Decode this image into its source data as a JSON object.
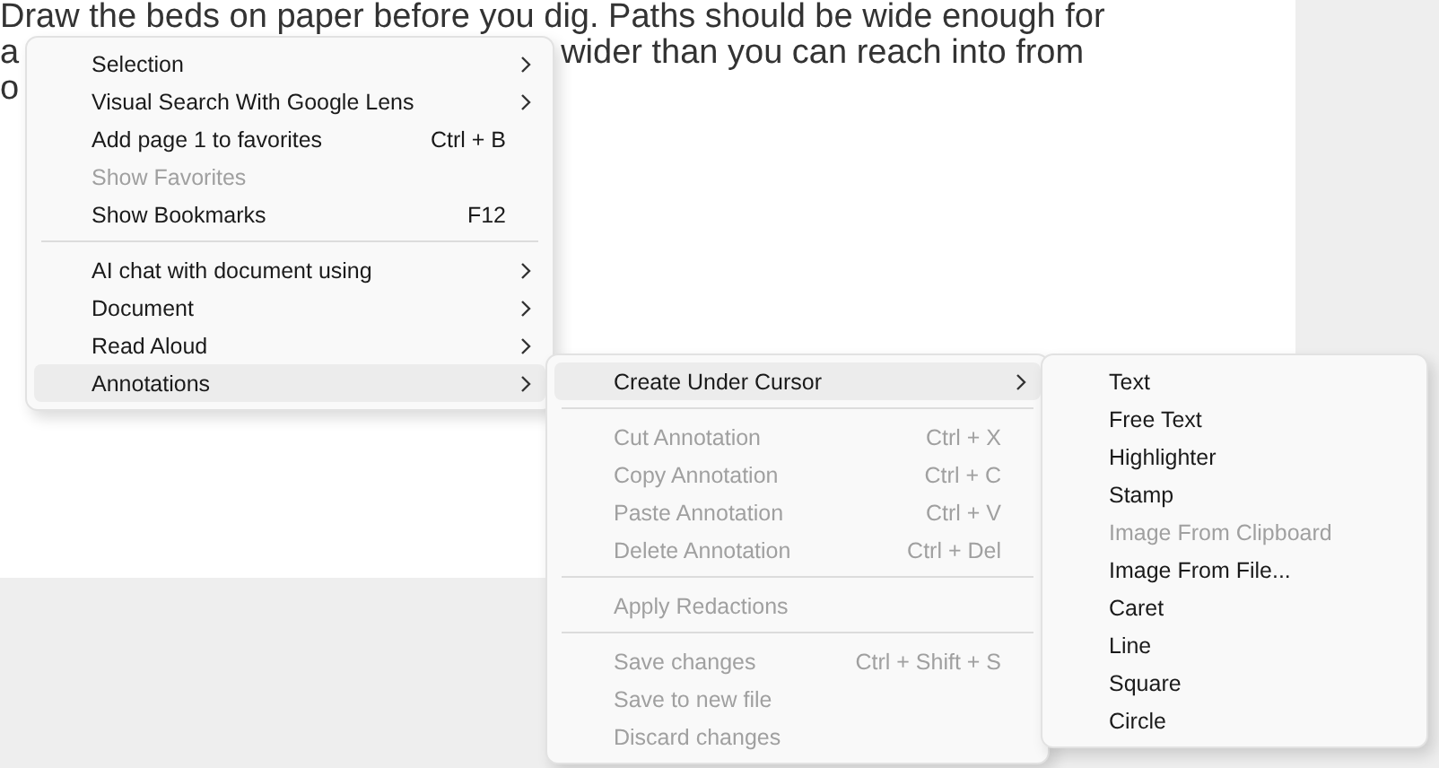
{
  "document": {
    "lines": [
      {
        "fragments": [
          "Draw the beds on paper before you dig. Paths should be wide enough for"
        ]
      },
      {
        "fragments": [
          "a",
          "wider than you can reach into from"
        ]
      },
      {
        "fragments": [
          "o"
        ]
      }
    ]
  },
  "context_menu": {
    "items": [
      {
        "kind": "item",
        "label": "Selection",
        "submenu": true,
        "disabled": false,
        "highlighted": false
      },
      {
        "kind": "item",
        "label": "Visual Search With Google Lens",
        "submenu": true,
        "disabled": false,
        "highlighted": false
      },
      {
        "kind": "item",
        "label": "Add page 1 to favorites",
        "shortcut": "Ctrl + B",
        "submenu": false,
        "disabled": false,
        "highlighted": false
      },
      {
        "kind": "item",
        "label": "Show Favorites",
        "submenu": false,
        "disabled": true,
        "highlighted": false
      },
      {
        "kind": "item",
        "label": "Show Bookmarks",
        "shortcut": "F12",
        "submenu": false,
        "disabled": false,
        "highlighted": false
      },
      {
        "kind": "separator"
      },
      {
        "kind": "item",
        "label": "AI chat with document using",
        "submenu": true,
        "disabled": false,
        "highlighted": false
      },
      {
        "kind": "item",
        "label": "Document",
        "submenu": true,
        "disabled": false,
        "highlighted": false
      },
      {
        "kind": "item",
        "label": "Read Aloud",
        "submenu": true,
        "disabled": false,
        "highlighted": false
      },
      {
        "kind": "item",
        "label": "Annotations",
        "submenu": true,
        "disabled": false,
        "highlighted": true
      }
    ]
  },
  "annotations_submenu": {
    "items": [
      {
        "kind": "item",
        "label": "Create Under Cursor",
        "submenu": true,
        "disabled": false,
        "highlighted": true
      },
      {
        "kind": "separator"
      },
      {
        "kind": "item",
        "label": "Cut Annotation",
        "shortcut": "Ctrl + X",
        "submenu": false,
        "disabled": true,
        "highlighted": false
      },
      {
        "kind": "item",
        "label": "Copy Annotation",
        "shortcut": "Ctrl + C",
        "submenu": false,
        "disabled": true,
        "highlighted": false
      },
      {
        "kind": "item",
        "label": "Paste Annotation",
        "shortcut": "Ctrl + V",
        "submenu": false,
        "disabled": true,
        "highlighted": false
      },
      {
        "kind": "item",
        "label": "Delete Annotation",
        "shortcut": "Ctrl + Del",
        "submenu": false,
        "disabled": true,
        "highlighted": false
      },
      {
        "kind": "separator"
      },
      {
        "kind": "item",
        "label": "Apply Redactions",
        "submenu": false,
        "disabled": true,
        "highlighted": false
      },
      {
        "kind": "separator"
      },
      {
        "kind": "item",
        "label": "Save changes",
        "shortcut": "Ctrl + Shift + S",
        "submenu": false,
        "disabled": true,
        "highlighted": false
      },
      {
        "kind": "item",
        "label": "Save to new file",
        "submenu": false,
        "disabled": true,
        "highlighted": false
      },
      {
        "kind": "item",
        "label": "Discard changes",
        "submenu": false,
        "disabled": true,
        "highlighted": false
      }
    ]
  },
  "create_submenu": {
    "items": [
      {
        "kind": "item",
        "label": "Text",
        "submenu": false,
        "disabled": false,
        "highlighted": false
      },
      {
        "kind": "item",
        "label": "Free Text",
        "submenu": false,
        "disabled": false,
        "highlighted": false
      },
      {
        "kind": "item",
        "label": "Highlighter",
        "submenu": false,
        "disabled": false,
        "highlighted": false
      },
      {
        "kind": "item",
        "label": "Stamp",
        "submenu": false,
        "disabled": false,
        "highlighted": false
      },
      {
        "kind": "item",
        "label": "Image From Clipboard",
        "submenu": false,
        "disabled": true,
        "highlighted": false
      },
      {
        "kind": "item",
        "label": "Image From File...",
        "submenu": false,
        "disabled": false,
        "highlighted": false
      },
      {
        "kind": "item",
        "label": "Caret",
        "submenu": false,
        "disabled": false,
        "highlighted": false
      },
      {
        "kind": "item",
        "label": "Line",
        "submenu": false,
        "disabled": false,
        "highlighted": false
      },
      {
        "kind": "item",
        "label": "Square",
        "submenu": false,
        "disabled": false,
        "highlighted": false
      },
      {
        "kind": "item",
        "label": "Circle",
        "submenu": false,
        "disabled": false,
        "highlighted": false
      }
    ]
  }
}
